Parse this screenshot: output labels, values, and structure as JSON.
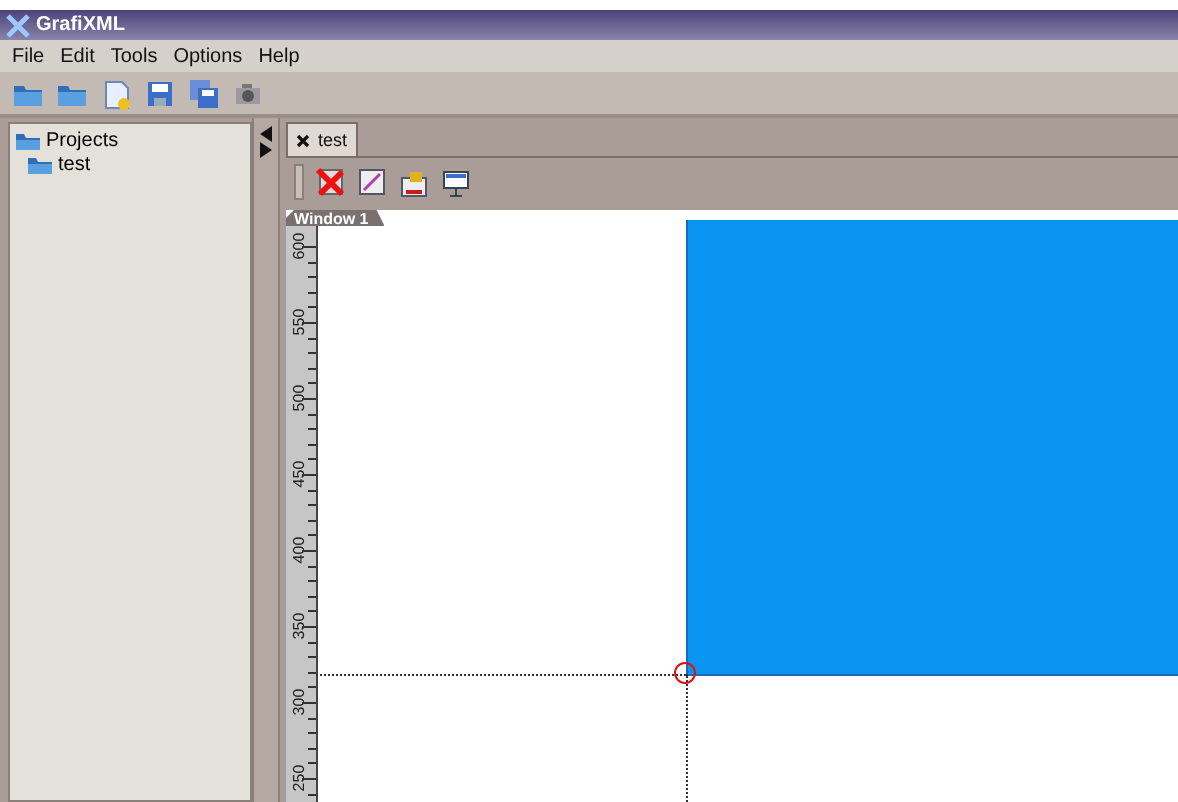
{
  "window": {
    "title": "GrafiXML"
  },
  "menu": [
    "File",
    "Edit",
    "Tools",
    "Options",
    "Help"
  ],
  "projects": [
    {
      "label": "Projects",
      "children": [
        {
          "label": "test"
        }
      ]
    }
  ],
  "tabs": [
    {
      "label": "test",
      "selected": true
    }
  ],
  "canvas": {
    "window_label": "Window 1",
    "ruler": [
      "600",
      "550",
      "500",
      "450",
      "400",
      "350",
      "300",
      "250"
    ]
  }
}
